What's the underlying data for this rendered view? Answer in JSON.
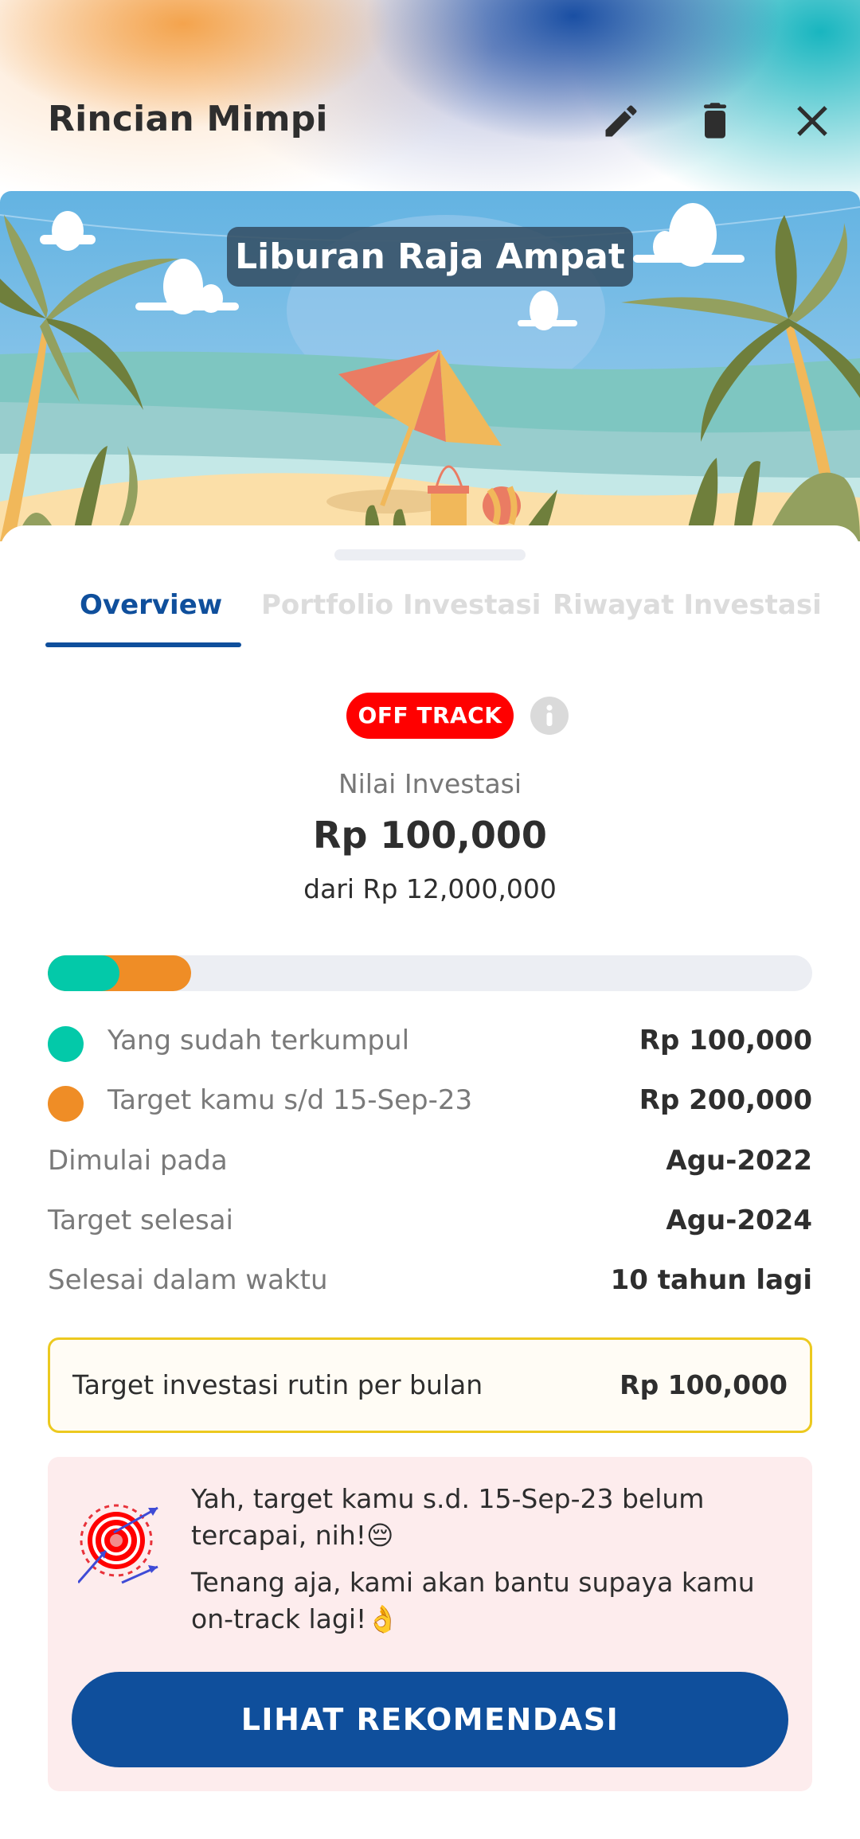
{
  "header": {
    "title": "Rincian Mimpi",
    "icons": [
      "edit-icon",
      "trash-icon",
      "close-icon"
    ]
  },
  "banner": {
    "title": "Liburan Raja Ampat",
    "image": "beach-illustration"
  },
  "tabs": [
    {
      "label": "Overview",
      "active": true
    },
    {
      "label": "Portfolio Investasi",
      "active": false
    },
    {
      "label": "Riwayat Investasi",
      "active": false
    }
  ],
  "status": {
    "badge": "OFF TRACK",
    "badge_color": "#ff0000",
    "info_icon": "info-icon"
  },
  "summary": {
    "label": "Nilai Investasi",
    "value": "Rp 100,000",
    "of_total": "dari Rp 12,000,000"
  },
  "progress": {
    "collected_fraction": 0.0083,
    "target_fraction": 0.0167,
    "collected_color": "#03c9a9",
    "target_color": "#ef8d26"
  },
  "legend": [
    {
      "label": "Yang sudah terkumpul",
      "value": "Rp 100,000",
      "color": "#03c9a9"
    },
    {
      "label": "Target kamu s/d 15-Sep-23",
      "value": "Rp 200,000",
      "color": "#ef8d26"
    }
  ],
  "details": [
    {
      "label": "Dimulai pada",
      "value": "Agu-2022"
    },
    {
      "label": "Target selesai",
      "value": "Agu-2024"
    },
    {
      "label": "Selesai dalam waktu",
      "value": "10 tahun lagi"
    }
  ],
  "monthly_target": {
    "label": "Target investasi rutin per bulan",
    "value": "Rp 100,000"
  },
  "alert": {
    "message_1": "Yah, target kamu s.d. 15-Sep-23 belum tercapai, nih!😔",
    "message_2": "Tenang aja, kami akan bantu supaya kamu on-track lagi!👌",
    "button_label": "LIHAT REKOMENDASI",
    "button_color": "#0f4f9c"
  }
}
